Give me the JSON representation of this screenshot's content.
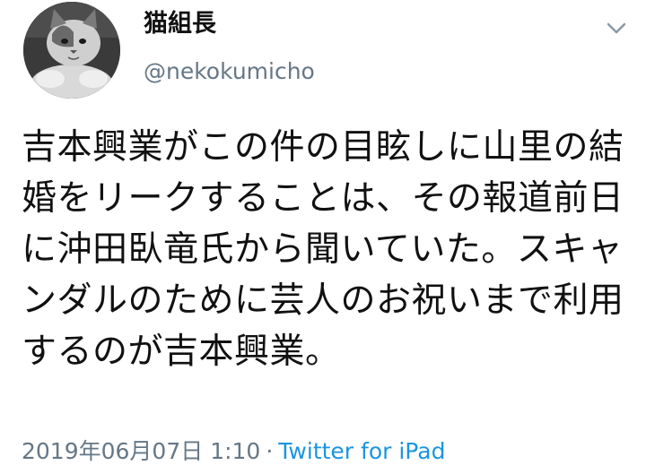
{
  "user": {
    "display_name": "猫組長",
    "handle": "@nekokumicho",
    "avatar_icon": "cat-avatar"
  },
  "menu": {
    "icon": "chevron-down-icon"
  },
  "tweet": {
    "text": "吉本興業がこの件の目眩しに山里の結婚をリークすることは、その報道前日に沖田臥竜氏から聞いていた。スキャンダルのために芸人のお祝いまで利用するのが吉本興業。",
    "timestamp": "2019年06月07日 1:10",
    "separator": "·",
    "source": "Twitter for iPad"
  },
  "colors": {
    "text": "#111111",
    "secondary": "#657786",
    "link": "#1b95e0"
  }
}
